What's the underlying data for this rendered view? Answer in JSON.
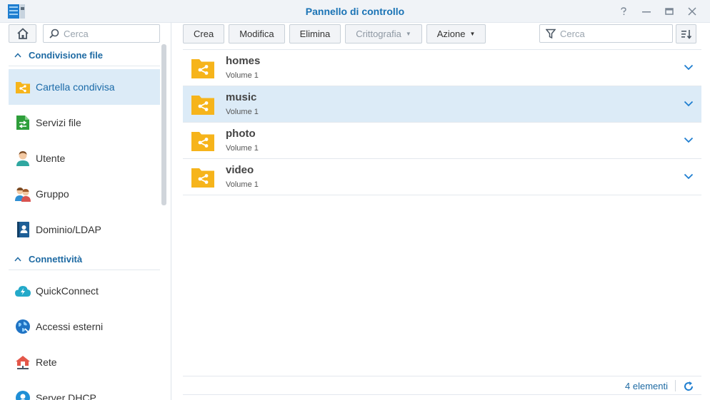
{
  "window": {
    "title": "Pannello di controllo",
    "controls": [
      "help-icon",
      "minimize-icon",
      "maximize-icon",
      "close-icon"
    ]
  },
  "sidebar": {
    "search_placeholder": "Cerca",
    "sections": [
      {
        "label": "Condivisione file",
        "items": [
          {
            "label": "Cartella condivisa",
            "icon": "shared-folder-icon",
            "active": true
          },
          {
            "label": "Servizi file",
            "icon": "file-services-icon"
          },
          {
            "label": "Utente",
            "icon": "user-icon"
          },
          {
            "label": "Gruppo",
            "icon": "group-icon"
          },
          {
            "label": "Dominio/LDAP",
            "icon": "domain-ldap-icon"
          }
        ]
      },
      {
        "label": "Connettività",
        "items": [
          {
            "label": "QuickConnect",
            "icon": "quickconnect-icon"
          },
          {
            "label": "Accessi esterni",
            "icon": "external-access-icon"
          },
          {
            "label": "Rete",
            "icon": "network-icon"
          },
          {
            "label": "Server DHCP",
            "icon": "dhcp-server-icon"
          }
        ]
      }
    ]
  },
  "toolbar": {
    "create": "Crea",
    "edit": "Modifica",
    "delete": "Elimina",
    "encryption": "Crittografia",
    "action": "Azione",
    "filter_placeholder": "Cerca"
  },
  "folders": [
    {
      "name": "homes",
      "volume": "Volume 1",
      "selected": false
    },
    {
      "name": "music",
      "volume": "Volume 1",
      "selected": true
    },
    {
      "name": "photo",
      "volume": "Volume 1",
      "selected": false
    },
    {
      "name": "video",
      "volume": "Volume 1",
      "selected": false
    }
  ],
  "footer": {
    "count": "4 elementi"
  },
  "colors": {
    "accent": "#1a73b5",
    "selection": "#dcebf7",
    "folder": "#f6b41b"
  }
}
